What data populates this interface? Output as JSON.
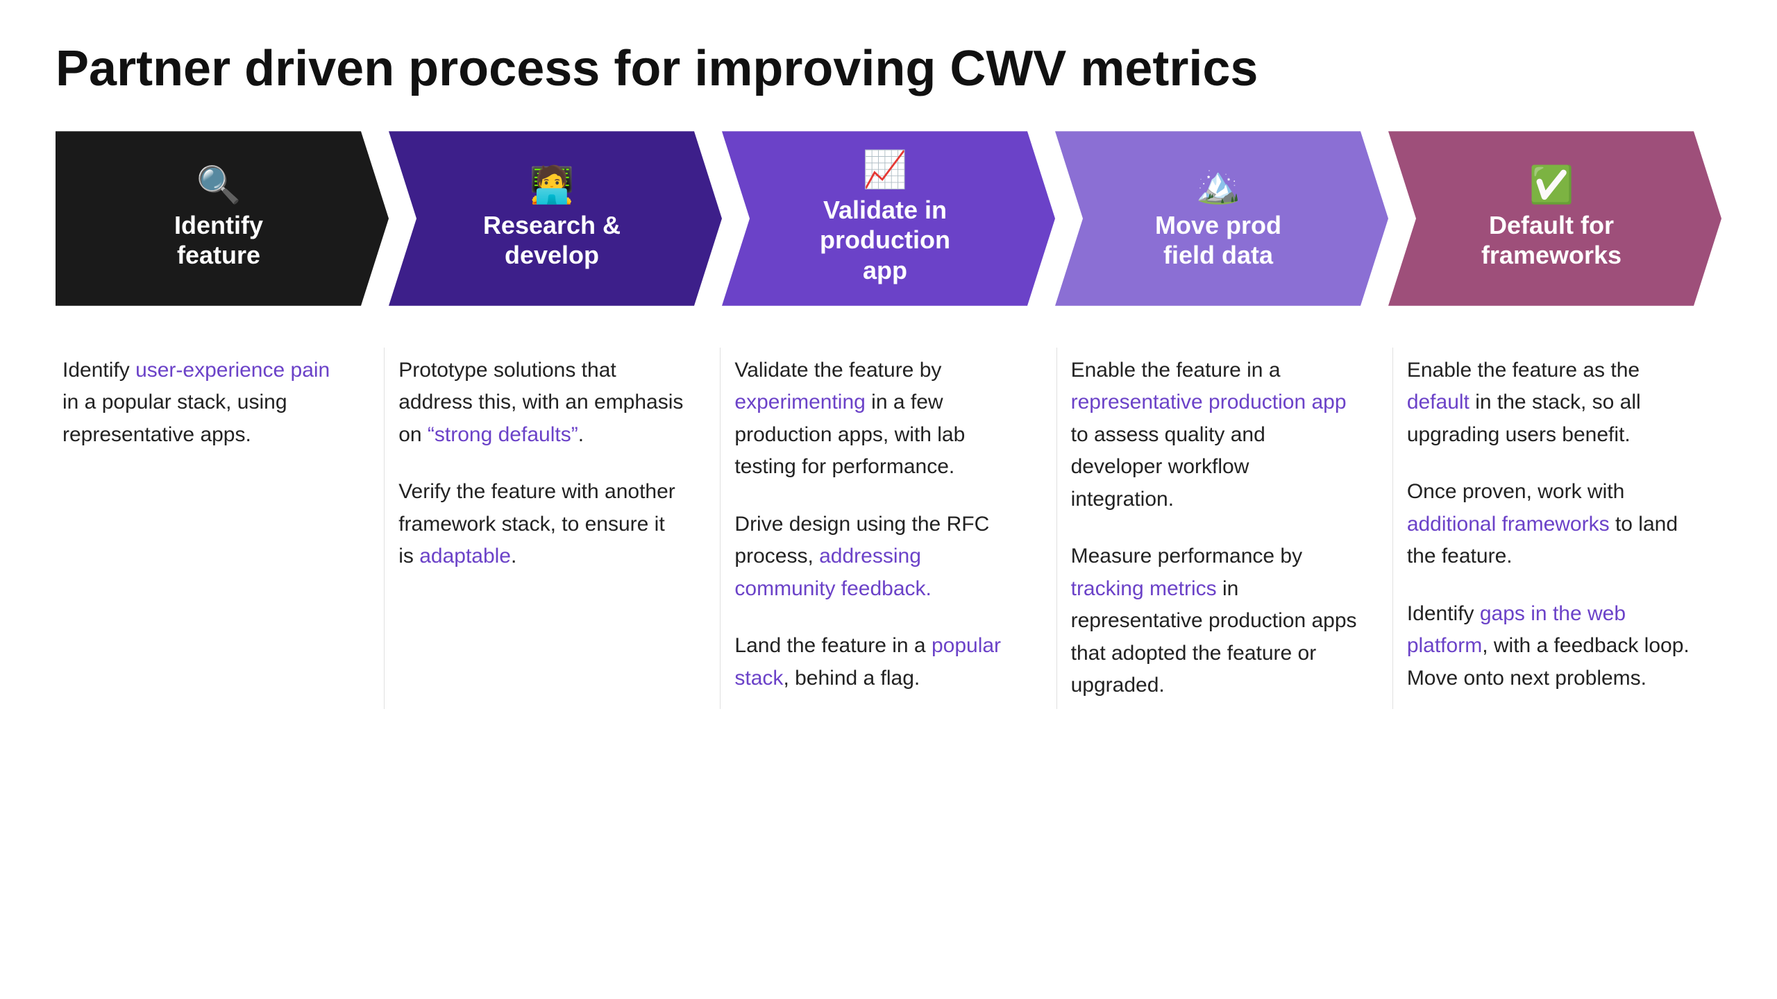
{
  "title": "Partner driven process for improving CWV metrics",
  "arrows": [
    {
      "id": "identify",
      "icon": "🔍",
      "label": "Identify\nfeature",
      "colorClass": "col-black"
    },
    {
      "id": "research",
      "icon": "🧑‍💻",
      "label": "Research &\ndevelop",
      "colorClass": "col-darkpurple"
    },
    {
      "id": "validate",
      "icon": "📈",
      "label": "Validate in\nproduction\napp",
      "colorClass": "col-mediumpurple"
    },
    {
      "id": "moveprod",
      "icon": "🏔️",
      "label": "Move prod\nfield data",
      "colorClass": "col-lightpurple"
    },
    {
      "id": "default",
      "icon": "✅",
      "label": "Default for\nframeworks",
      "colorClass": "col-mauve"
    }
  ],
  "columns": [
    {
      "id": "identify-content",
      "paragraphs": [
        {
          "parts": [
            {
              "text": "Identify ",
              "type": "plain"
            },
            {
              "text": "user-experience pain",
              "type": "link"
            },
            {
              "text": " in a popular stack, using representative apps.",
              "type": "plain"
            }
          ]
        }
      ]
    },
    {
      "id": "research-content",
      "paragraphs": [
        {
          "parts": [
            {
              "text": "Prototype solutions that address this, with an emphasis on ",
              "type": "plain"
            },
            {
              "text": "“strong defaults”",
              "type": "link"
            },
            {
              "text": ".",
              "type": "plain"
            }
          ]
        },
        {
          "parts": [
            {
              "text": "Verify the feature with another framework stack, to ensure it is ",
              "type": "plain"
            },
            {
              "text": "adaptable",
              "type": "link"
            },
            {
              "text": ".",
              "type": "plain"
            }
          ]
        }
      ]
    },
    {
      "id": "validate-content",
      "paragraphs": [
        {
          "parts": [
            {
              "text": "Validate the feature by ",
              "type": "plain"
            },
            {
              "text": "experimenting",
              "type": "link"
            },
            {
              "text": " in a few production apps, with lab testing for performance.",
              "type": "plain"
            }
          ]
        },
        {
          "parts": [
            {
              "text": "Drive design using the RFC process, ",
              "type": "plain"
            },
            {
              "text": "addressing community feedback.",
              "type": "link"
            }
          ]
        },
        {
          "parts": [
            {
              "text": "Land the feature in a ",
              "type": "plain"
            },
            {
              "text": "popular stack",
              "type": "link"
            },
            {
              "text": ", behind a flag.",
              "type": "plain"
            }
          ]
        }
      ]
    },
    {
      "id": "moveprod-content",
      "paragraphs": [
        {
          "parts": [
            {
              "text": "Enable the feature in a ",
              "type": "plain"
            },
            {
              "text": "representative production app",
              "type": "link"
            },
            {
              "text": " to assess quality and developer workflow integration.",
              "type": "plain"
            }
          ]
        },
        {
          "parts": [
            {
              "text": "Measure performance by ",
              "type": "plain"
            },
            {
              "text": "tracking metrics",
              "type": "link"
            },
            {
              "text": " in representative production apps that adopted the feature or upgraded.",
              "type": "plain"
            }
          ]
        }
      ]
    },
    {
      "id": "default-content",
      "paragraphs": [
        {
          "parts": [
            {
              "text": "Enable the feature as the ",
              "type": "plain"
            },
            {
              "text": "default",
              "type": "link"
            },
            {
              "text": " in the stack, so all upgrading users benefit.",
              "type": "plain"
            }
          ]
        },
        {
          "parts": [
            {
              "text": "Once proven, work with ",
              "type": "plain"
            },
            {
              "text": "additional frameworks",
              "type": "link"
            },
            {
              "text": " to land the feature.",
              "type": "plain"
            }
          ]
        },
        {
          "parts": [
            {
              "text": "Identify ",
              "type": "plain"
            },
            {
              "text": "gaps in the web platform",
              "type": "link"
            },
            {
              "text": ", with a feedback loop. Move onto next problems.",
              "type": "plain"
            }
          ]
        }
      ]
    }
  ]
}
